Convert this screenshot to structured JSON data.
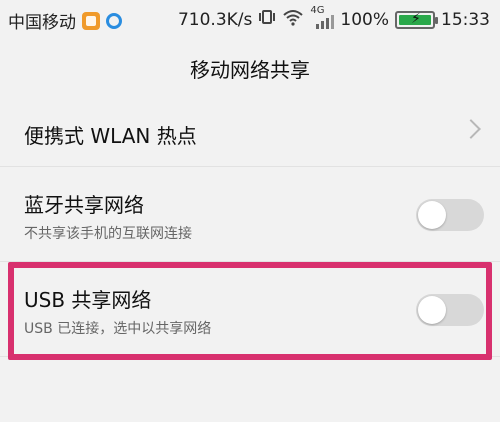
{
  "status_bar": {
    "carrier": "中国移动",
    "speed": "710.3K/s",
    "network_badge": "4G",
    "battery_text": "100%",
    "time": "15:33",
    "icons": {
      "vibrate": "vibrate-icon",
      "wifi": "wifi-icon",
      "signal": "signal-icon",
      "battery": "battery-charging-icon"
    },
    "battery_level": 1.0
  },
  "header": {
    "title": "移动网络共享"
  },
  "settings": {
    "wlan_hotspot": {
      "title": "便携式 WLAN 热点"
    },
    "bluetooth_tethering": {
      "title": "蓝牙共享网络",
      "subtitle": "不共享该手机的互联网连接",
      "enabled": false
    },
    "usb_tethering": {
      "title": "USB 共享网络",
      "subtitle": "USB 已连接，选中以共享网络",
      "enabled": false
    }
  },
  "colors": {
    "background": "#f2f2f2",
    "highlight": "#d8306e",
    "toggle_off": "#d8d8d8",
    "battery": "#2aa84a"
  }
}
